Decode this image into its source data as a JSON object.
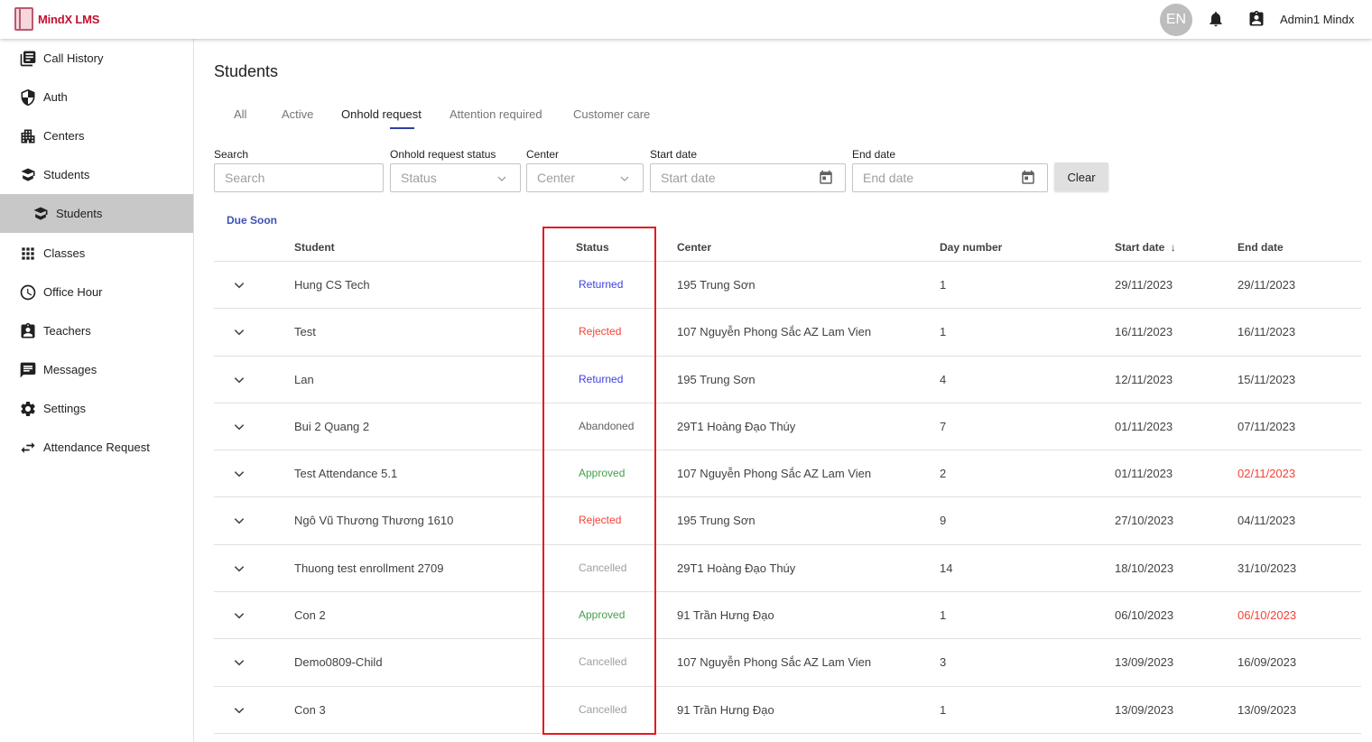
{
  "app": {
    "logo_text": "MindX LMS",
    "language": "EN",
    "user_name": "Admin1 Mindx"
  },
  "sidebar": {
    "items": [
      {
        "label": "Call History",
        "icon": "call-history-icon"
      },
      {
        "label": "Auth",
        "icon": "shield-icon"
      },
      {
        "label": "Centers",
        "icon": "centers-icon"
      },
      {
        "label": "Students",
        "icon": "student-icon"
      },
      {
        "label": "Students",
        "icon": "student-icon",
        "sub": true,
        "selected": true
      },
      {
        "label": "Classes",
        "icon": "grid-icon"
      },
      {
        "label": "Office Hour",
        "icon": "clock-icon"
      },
      {
        "label": "Teachers",
        "icon": "teacher-icon"
      },
      {
        "label": "Messages",
        "icon": "message-icon"
      },
      {
        "label": "Settings",
        "icon": "gear-icon"
      },
      {
        "label": "Attendance Request",
        "icon": "swap-icon"
      }
    ]
  },
  "page": {
    "title": "Students",
    "tabs": [
      "All",
      "Active",
      "Onhold request",
      "Attention required",
      "Customer care"
    ],
    "active_tab": "Onhold request"
  },
  "filters": {
    "search_label": "Search",
    "search_placeholder": "Search",
    "status_label": "Onhold request status",
    "status_placeholder": "Status",
    "center_label": "Center",
    "center_placeholder": "Center",
    "start_label": "Start date",
    "start_placeholder": "Start date",
    "end_label": "End date",
    "end_placeholder": "End date",
    "clear_label": "Clear"
  },
  "due_soon_label": "Due Soon",
  "table": {
    "headers": {
      "student": "Student",
      "status": "Status",
      "center": "Center",
      "day_number": "Day number",
      "start_date": "Start date",
      "end_date": "End date"
    },
    "sort_indicator": "↓",
    "rows": [
      {
        "student": "Hung CS Tech",
        "status": "Returned",
        "center": "195 Trung Sơn",
        "day_number": "1",
        "start_date": "29/11/2023",
        "end_date": "29/11/2023",
        "end_overdue": false
      },
      {
        "student": "Test",
        "status": "Rejected",
        "center": "107 Nguyễn Phong Sắc AZ Lam Vien",
        "day_number": "1",
        "start_date": "16/11/2023",
        "end_date": "16/11/2023",
        "end_overdue": false
      },
      {
        "student": "Lan",
        "status": "Returned",
        "center": "195 Trung Sơn",
        "day_number": "4",
        "start_date": "12/11/2023",
        "end_date": "15/11/2023",
        "end_overdue": false
      },
      {
        "student": "Bui 2 Quang 2",
        "status": "Abandoned",
        "center": "29T1 Hoàng Đạo Thúy",
        "day_number": "7",
        "start_date": "01/11/2023",
        "end_date": "07/11/2023",
        "end_overdue": false
      },
      {
        "student": "Test Attendance 5.1",
        "status": "Approved",
        "center": "107 Nguyễn Phong Sắc AZ Lam Vien",
        "day_number": "2",
        "start_date": "01/11/2023",
        "end_date": "02/11/2023",
        "end_overdue": true
      },
      {
        "student": "Ngô Vũ Thương Thương 1610",
        "status": "Rejected",
        "center": "195 Trung Sơn",
        "day_number": "9",
        "start_date": "27/10/2023",
        "end_date": "04/11/2023",
        "end_overdue": false
      },
      {
        "student": "Thuong test enrollment 2709",
        "status": "Cancelled",
        "center": "29T1 Hoàng Đạo Thúy",
        "day_number": "14",
        "start_date": "18/10/2023",
        "end_date": "31/10/2023",
        "end_overdue": false
      },
      {
        "student": "Con 2",
        "status": "Approved",
        "center": "91 Trần Hưng Đạo",
        "day_number": "1",
        "start_date": "06/10/2023",
        "end_date": "06/10/2023",
        "end_overdue": true
      },
      {
        "student": "Demo0809-Child",
        "status": "Cancelled",
        "center": "107 Nguyễn Phong Sắc AZ Lam Vien",
        "day_number": "3",
        "start_date": "13/09/2023",
        "end_date": "16/09/2023",
        "end_overdue": false
      },
      {
        "student": "Con 3",
        "status": "Cancelled",
        "center": "91 Trần Hưng Đạo",
        "day_number": "1",
        "start_date": "13/09/2023",
        "end_date": "13/09/2023",
        "end_overdue": false
      }
    ]
  },
  "colors": {
    "accent": "#3f51b5",
    "returned": "#3f3fe0",
    "rejected": "#f44336",
    "approved": "#43a047",
    "cancelled": "#9e9e9e",
    "highlight": "#e21b23"
  }
}
